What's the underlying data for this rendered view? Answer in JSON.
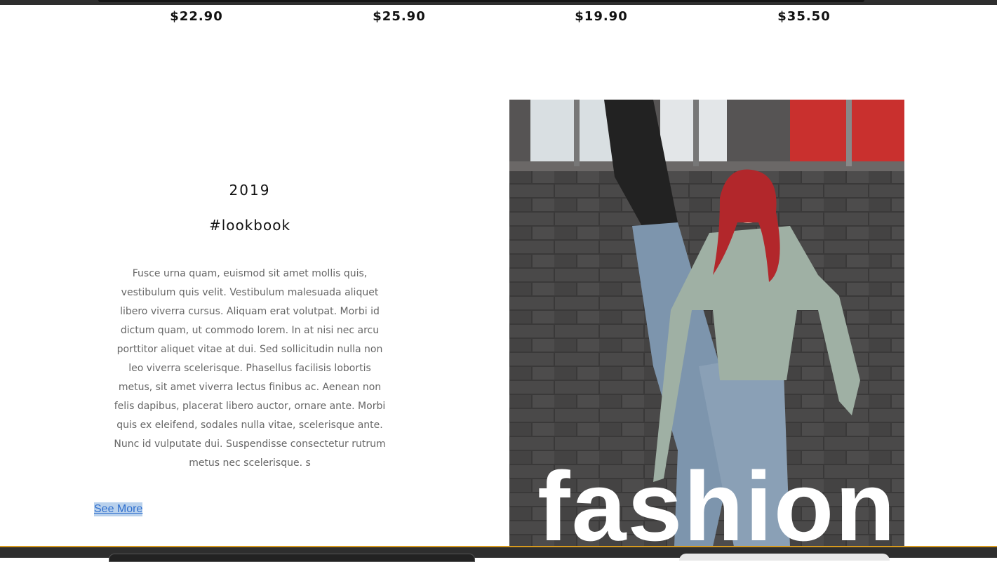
{
  "prices": [
    "$22.90",
    "$25.90",
    "$19.90",
    "$35.50"
  ],
  "lookbook": {
    "year": "2019",
    "tag": "#lookbook",
    "body": "Fusce urna quam, euismod sit amet mollis quis, vestibulum quis velit. Vestibulum malesuada aliquet libero viverra cursus. Aliquam erat volutpat. Morbi id dictum quam, ut commodo lorem. In at nisi nec arcu porttitor aliquet vitae at dui. Sed sollicitudin nulla non leo viverra scelerisque. Phasellus facilisis lobortis metus, sit amet viverra lectus finibus ac. Aenean non felis dapibus, placerat libero auctor, ornare ante. Morbi quis ex eleifend, sodales nulla vitae, scelerisque ante. Nunc id vulputate dui. Suspendisse consectetur rutrum metus nec scelerisque. s",
    "see_more": "See More"
  },
  "photo": {
    "overlay_text": "fashion"
  },
  "colors": {
    "accent_line": "#d79a1e",
    "link": "#2f6fce",
    "link_highlight": "#b9d1ec",
    "bar": "#2e2e2e"
  }
}
